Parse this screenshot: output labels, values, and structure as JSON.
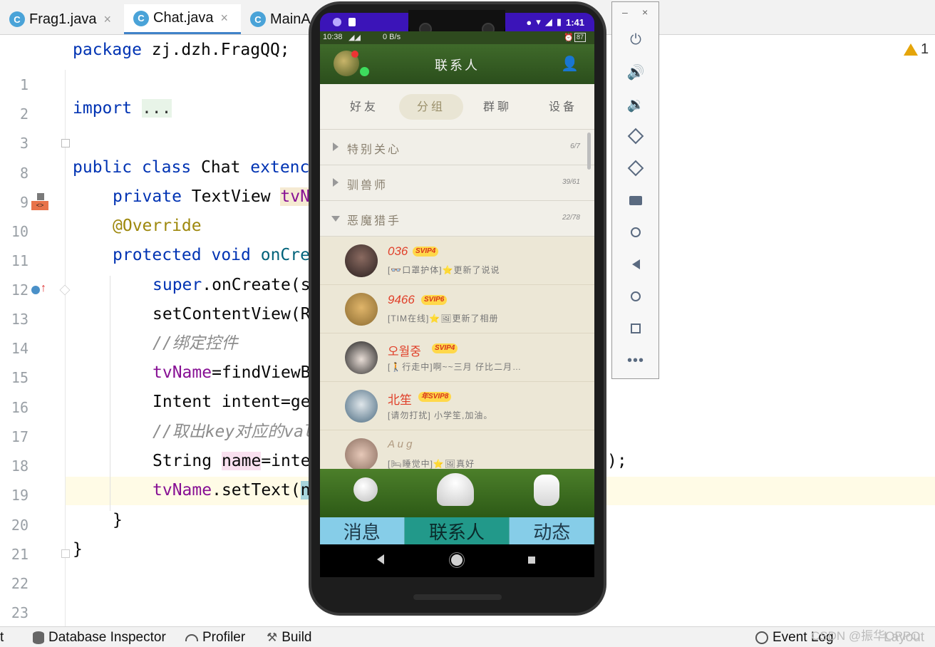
{
  "tabs": [
    {
      "icon": "C",
      "label": "Frag1.java"
    },
    {
      "icon": "C",
      "label": "Chat.java"
    },
    {
      "icon": "C",
      "label": "MainA"
    }
  ],
  "line_numbers": [
    "1",
    "2",
    "3",
    "8",
    "9",
    "10",
    "11",
    "12",
    "13",
    "14",
    "15",
    "16",
    "17",
    "18",
    "19",
    "20",
    "21",
    "22",
    "23"
  ],
  "code": {
    "l1_kw": "package",
    "l1_rest": " zj.dzh.FragQQ;",
    "l3_kw": "import",
    "l3_fold": "...",
    "l9_kw1": "public",
    "l9_kw2": "class",
    "l9_name": " Chat ",
    "l9_kw3": "extenc",
    "l10_kw": "private",
    "l10_type": " TextView ",
    "l10_var": "tvN",
    "l11_ann": "@Override",
    "l12_kw1": "protected",
    "l12_kw2": "void",
    "l12_method": "onCre",
    "l13_kw": "super",
    "l13_rest": ".onCreate(s",
    "l14_text": "setContentView(R",
    "l15_cmt": "//绑定控件",
    "l16_var": "tvName",
    "l16_rest": "=findViewB",
    "l17_text": "Intent intent=ge",
    "l18_cmt": "//取出key对应的val",
    "l19_text1": "String ",
    "l19_var": "name",
    "l19_text2": "=inte",
    "l19_tail": ");",
    "l20_var": "tvName",
    "l20_rest": ".setText(",
    "l20_cursor": "n",
    "l21_text": "}",
    "l22_text": "}"
  },
  "warning_count": "1",
  "status": {
    "item0": "t",
    "database_inspector": "Database Inspector",
    "profiler": "Profiler",
    "build": "Build",
    "event_log": "Event Log",
    "layout": "Layout"
  },
  "watermark": "CSDN @振华OPPO",
  "emulator_panel": {
    "minimize": "–",
    "close": "×",
    "buttons": [
      "power-icon",
      "volume-up-icon",
      "volume-down-icon",
      "rotate-left-icon",
      "rotate-right-icon",
      "camera-icon",
      "zoom-icon",
      "back-icon",
      "home-icon",
      "overview-icon",
      "more-icon"
    ]
  },
  "phone": {
    "clock": "1:41",
    "app_status_left": "10:38",
    "app_status_net": "0 B/s",
    "app_status_battery": "87",
    "title": "联系人",
    "segments": [
      "好友",
      "分组",
      "群聊",
      "设备"
    ],
    "selected_segment": "分组",
    "groups": [
      {
        "name": "特别关心",
        "count": "6/7"
      },
      {
        "name": "驯兽师",
        "count": "39/61"
      },
      {
        "name": "恶魔猎手",
        "count": "22/78"
      }
    ],
    "contacts": [
      {
        "name": "036",
        "badge": "SVIP4",
        "status": "[👓口罩护体]⭐更新了说说",
        "color": "#3a3030"
      },
      {
        "name": "9466",
        "badge": "SVIP6",
        "status": "[TIM在线]⭐🖼更新了相册",
        "color": "#c89a4a"
      },
      {
        "name": "오월중",
        "badge": "SVIP4",
        "status": "[🚶行走中]啊~~三月    仔比二月…",
        "color": "#2b2b2b"
      },
      {
        "name": "北笙",
        "badge": "年SVIP8",
        "status": "[请勿打扰] 小学笙,加油。",
        "color": "#6a8aa0"
      },
      {
        "name": "A u g",
        "badge": "",
        "status": "[🛏睡觉中]⭐🖼真好",
        "color": "#b89a84"
      }
    ],
    "bottom_nav": [
      "消息",
      "联系人",
      "动态"
    ],
    "bottom_nav_selected": "联系人"
  }
}
